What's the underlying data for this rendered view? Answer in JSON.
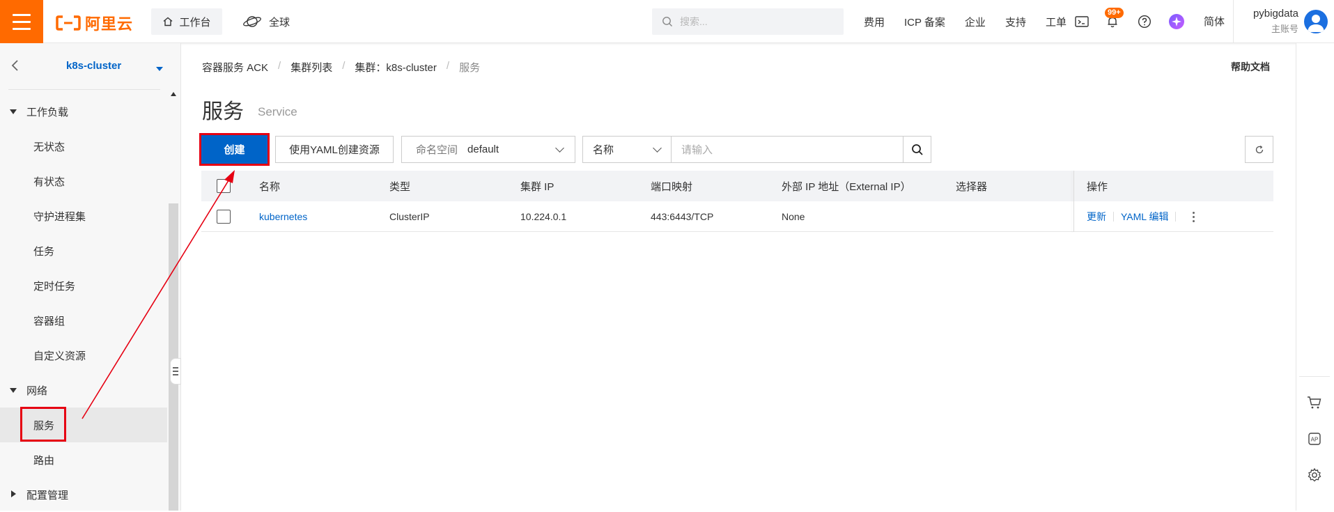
{
  "topbar": {
    "logo_text": "阿里云",
    "workbench": "工作台",
    "global": "全球",
    "search_placeholder": "搜索...",
    "links": [
      "费用",
      "ICP 备案",
      "企业",
      "支持",
      "工单"
    ],
    "notification_badge": "99+",
    "language": "简体",
    "user_name": "pybigdata",
    "user_role": "主账号",
    "accent_color": "#ff6a00"
  },
  "sidebar": {
    "cluster_name": "k8s-cluster",
    "items": [
      {
        "label": "工作负载",
        "kind": "group",
        "expanded": true
      },
      {
        "label": "无状态",
        "kind": "sub"
      },
      {
        "label": "有状态",
        "kind": "sub"
      },
      {
        "label": "守护进程集",
        "kind": "sub"
      },
      {
        "label": "任务",
        "kind": "sub"
      },
      {
        "label": "定时任务",
        "kind": "sub"
      },
      {
        "label": "容器组",
        "kind": "sub"
      },
      {
        "label": "自定义资源",
        "kind": "sub"
      },
      {
        "label": "网络",
        "kind": "group",
        "expanded": true
      },
      {
        "label": "服务",
        "kind": "sub",
        "active": true
      },
      {
        "label": "路由",
        "kind": "sub"
      },
      {
        "label": "配置管理",
        "kind": "group",
        "expanded": false
      }
    ]
  },
  "breadcrumb": [
    "容器服务 ACK",
    "集群列表",
    "集群：k8s-cluster",
    "服务"
  ],
  "help_doc": "帮助文档",
  "page": {
    "title": "服务",
    "subtitle": "Service"
  },
  "toolbar": {
    "create_label": "创建",
    "yaml_create_label": "使用YAML创建资源",
    "namespace_label": "命名空间",
    "namespace_value": "default",
    "filter_field": "名称",
    "filter_placeholder": "请输入"
  },
  "table": {
    "columns": [
      "名称",
      "类型",
      "集群 IP",
      "端口映射",
      "外部 IP 地址（External IP）",
      "选择器",
      "操作"
    ],
    "rows": [
      {
        "name": "kubernetes",
        "type": "ClusterIP",
        "cluster_ip": "10.224.0.1",
        "ports": "443:6443/TCP",
        "external_ip": "None",
        "selector": "",
        "actions": [
          "更新",
          "YAML 编辑"
        ]
      }
    ]
  },
  "annotation_color": "#e60012",
  "brand_blue": "#0064c8"
}
